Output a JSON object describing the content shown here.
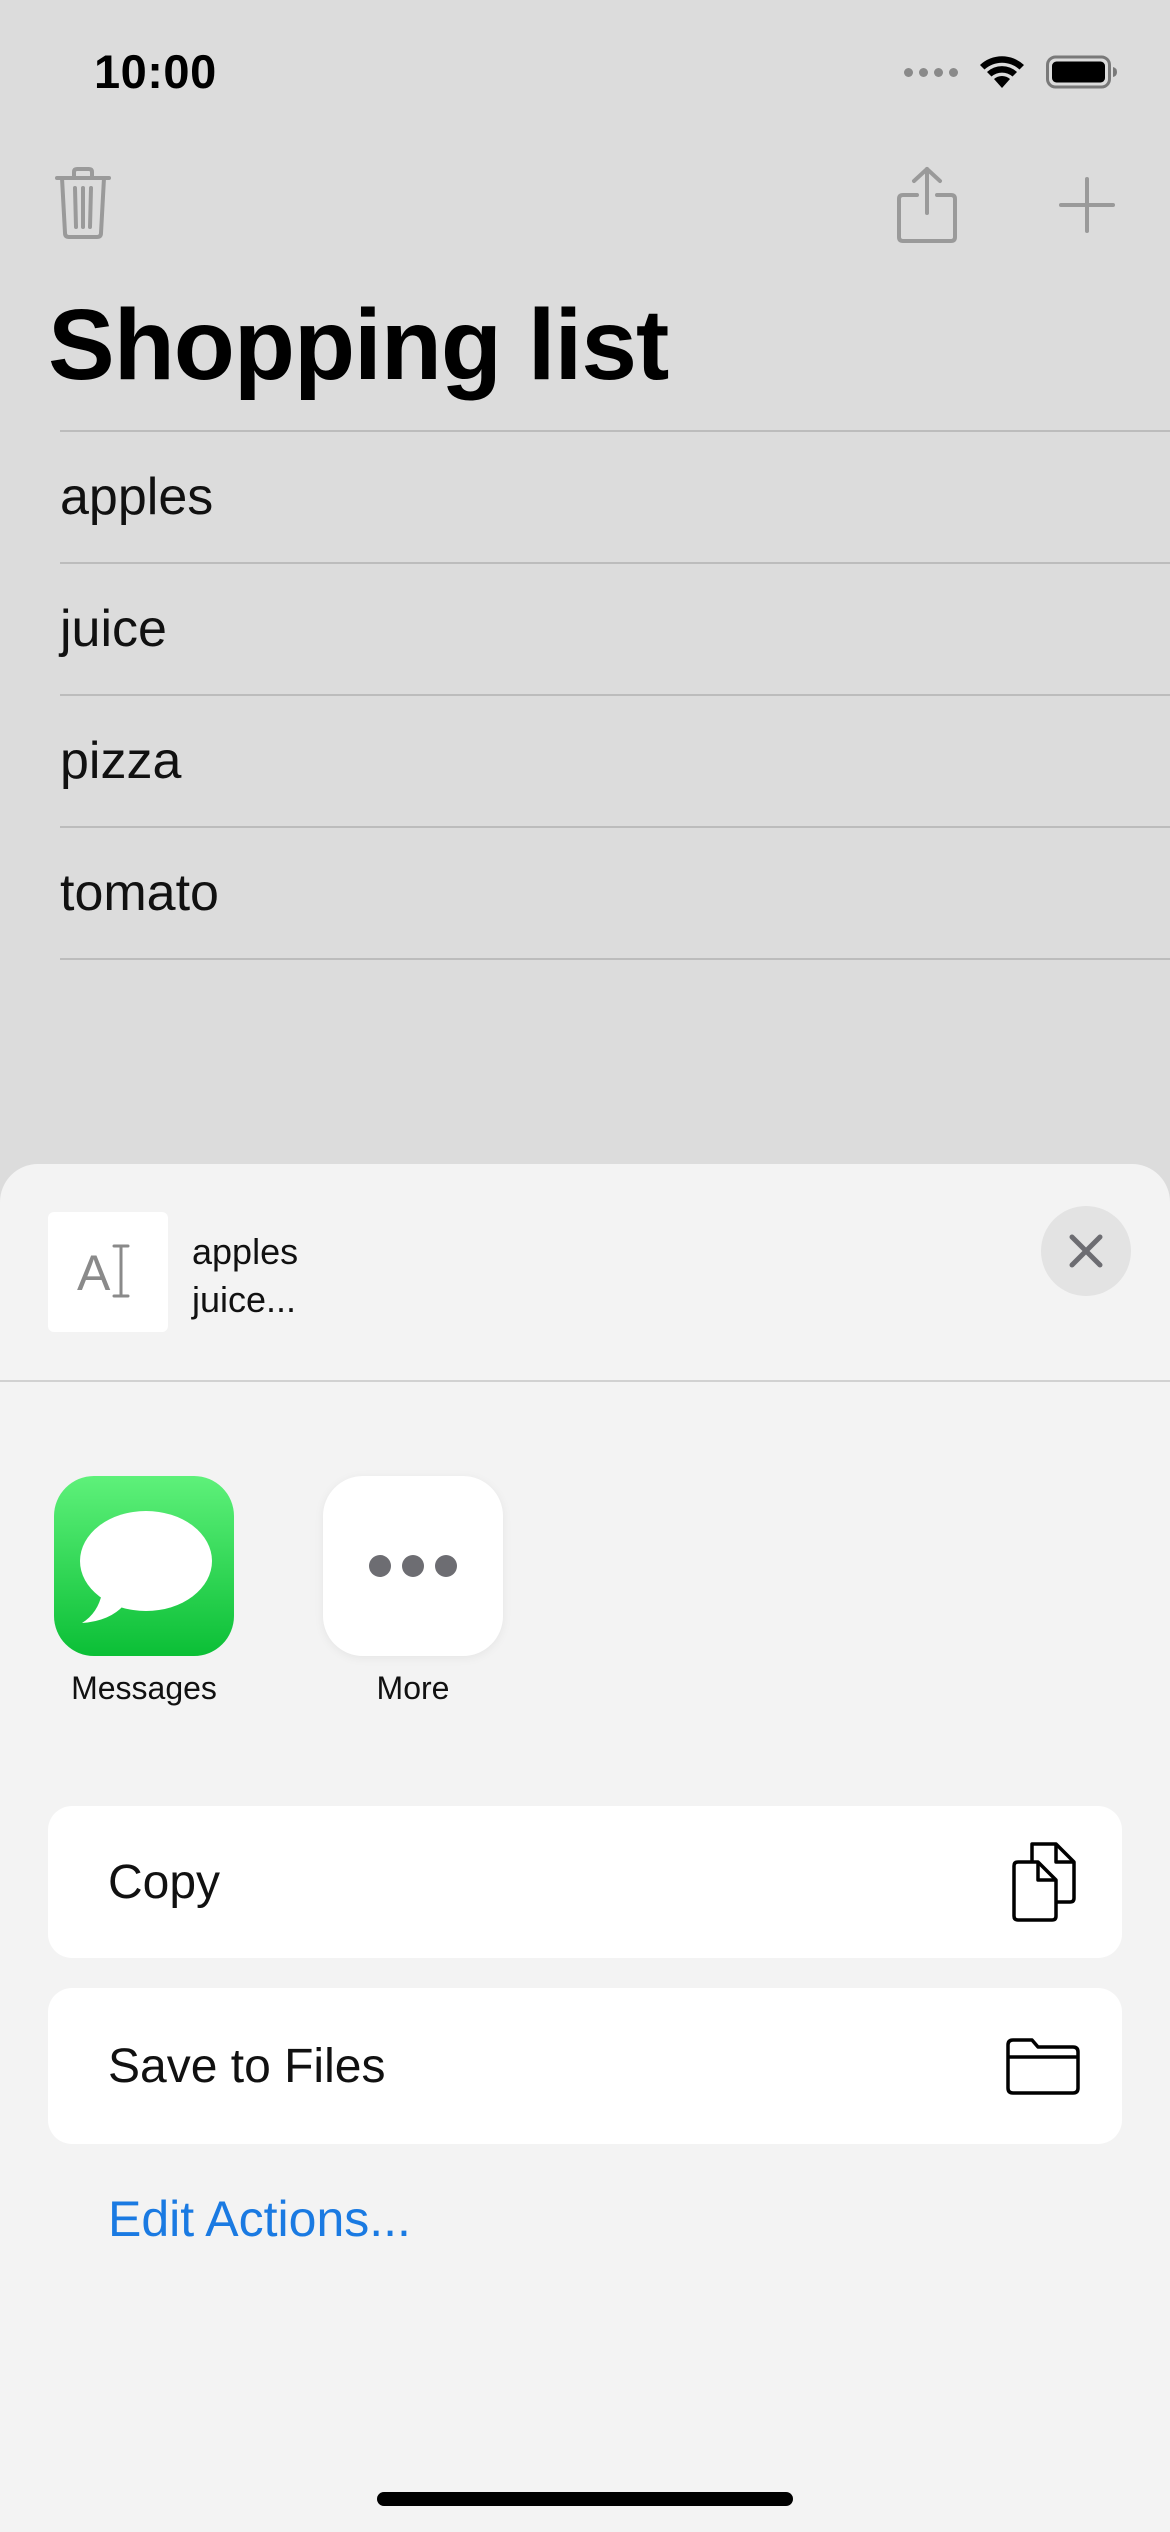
{
  "status_bar": {
    "time": "10:00",
    "icons": [
      "cellular-signal-icon",
      "wifi-icon",
      "battery-icon"
    ]
  },
  "toolbar": {
    "icons": [
      "trash-icon",
      "share-icon",
      "plus-icon"
    ]
  },
  "page": {
    "title": "Shopping list"
  },
  "list": {
    "items": [
      "apples",
      "juice",
      "pizza",
      "tomato"
    ]
  },
  "share_sheet": {
    "preview_line1": "apples",
    "preview_line2": "juice...",
    "preview_icon": "text-document-icon",
    "close_icon": "close-icon",
    "apps": [
      {
        "label": "Messages",
        "icon": "messages-icon"
      },
      {
        "label": "More",
        "icon": "more-dots-icon"
      }
    ],
    "actions": [
      {
        "label": "Copy",
        "icon": "copy-icon"
      },
      {
        "label": "Save to Files",
        "icon": "folder-icon"
      }
    ],
    "edit_actions_label": "Edit Actions..."
  },
  "colors": {
    "background": "#dcdcdc",
    "sheet_background": "#f3f3f3",
    "link_blue": "#1a7ae2",
    "messages_green": "#0bbf36"
  }
}
